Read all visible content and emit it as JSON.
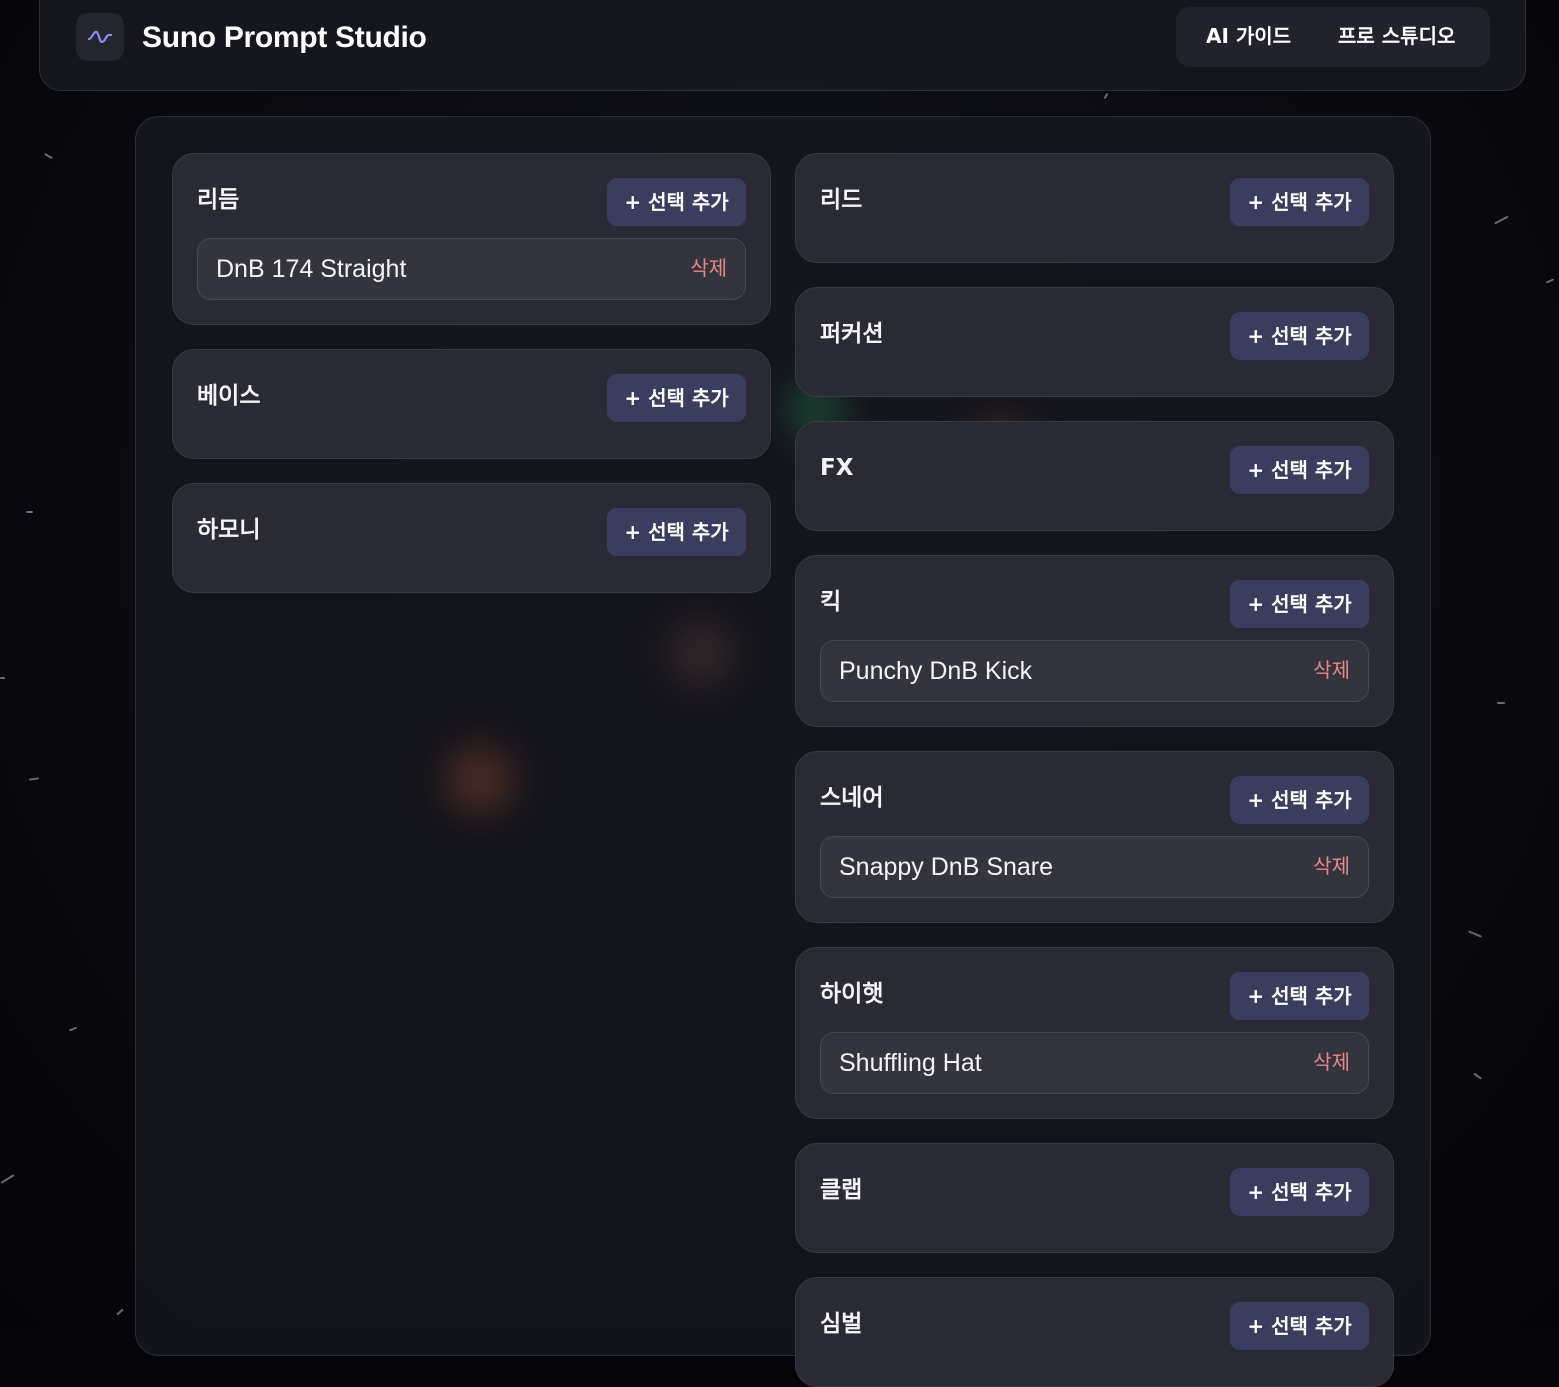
{
  "app": {
    "title": "Suno Prompt Studio",
    "logo_icon": "waveform-icon",
    "accent": "#8b8cf0"
  },
  "nav": {
    "items": [
      {
        "label": "AI 가이드"
      },
      {
        "label": "프로 스튜디오"
      }
    ]
  },
  "colors": {
    "add_button_bg": "#3b3d5e",
    "delete_text": "#e58a8a",
    "card_bg": "#2a2a34"
  },
  "left_column": [
    {
      "title": "리듬",
      "add_label": "+ 선택 추가",
      "items": [
        {
          "name": "DnB 174 Straight",
          "delete_label": "삭제"
        }
      ]
    },
    {
      "title": "베이스",
      "add_label": "+ 선택 추가",
      "items": []
    },
    {
      "title": "하모니",
      "add_label": "+ 선택 추가",
      "items": []
    }
  ],
  "right_column": [
    {
      "title": "리드",
      "add_label": "+ 선택 추가",
      "items": []
    },
    {
      "title": "퍼커션",
      "add_label": "+ 선택 추가",
      "items": []
    },
    {
      "title": "FX",
      "add_label": "+ 선택 추가",
      "items": []
    },
    {
      "title": "킥",
      "add_label": "+ 선택 추가",
      "items": [
        {
          "name": "Punchy DnB Kick",
          "delete_label": "삭제"
        }
      ]
    },
    {
      "title": "스네어",
      "add_label": "+ 선택 추가",
      "items": [
        {
          "name": "Snappy DnB Snare",
          "delete_label": "삭제"
        }
      ]
    },
    {
      "title": "하이햇",
      "add_label": "+ 선택 추가",
      "items": [
        {
          "name": "Shuffling Hat",
          "delete_label": "삭제"
        }
      ]
    },
    {
      "title": "클랩",
      "add_label": "+ 선택 추가",
      "items": []
    },
    {
      "title": "심벌",
      "add_label": "+ 선택 추가",
      "items": []
    }
  ]
}
